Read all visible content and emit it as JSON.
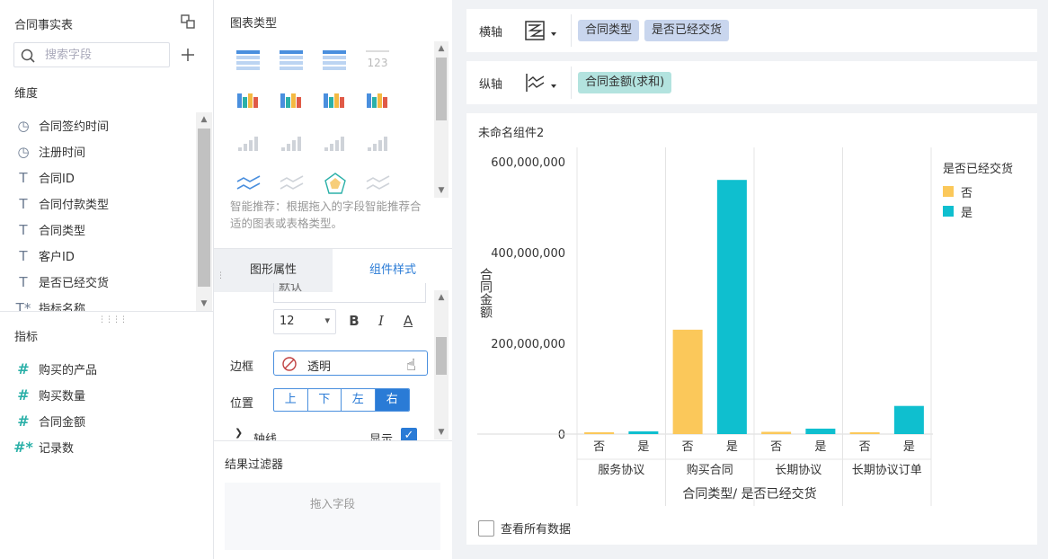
{
  "left_panel": {
    "title": "合同事实表",
    "search_placeholder": "搜索字段",
    "dimension_label": "维度",
    "dimensions": [
      {
        "icon": "clock-icon",
        "label": "合同签约时间"
      },
      {
        "icon": "clock-icon",
        "label": "注册时间"
      },
      {
        "icon": "text-icon",
        "label": "合同ID"
      },
      {
        "icon": "text-icon",
        "label": "合同付款类型"
      },
      {
        "icon": "text-icon",
        "label": "合同类型"
      },
      {
        "icon": "text-icon",
        "label": "客户ID"
      },
      {
        "icon": "text-icon",
        "label": "是否已经交货"
      },
      {
        "icon": "calculated-text-icon",
        "label": "指标名称"
      }
    ],
    "measure_label": "指标",
    "measures": [
      {
        "icon": "number-icon",
        "label": "购买的产品"
      },
      {
        "icon": "number-icon",
        "label": "购买数量"
      },
      {
        "icon": "number-icon",
        "label": "合同金额"
      },
      {
        "icon": "calculated-number-icon",
        "label": "记录数"
      }
    ]
  },
  "middle_panel": {
    "chart_type_title": "图表类型",
    "chart_type_icons": [
      "grouped-table-icon",
      "detail-table-icon",
      "cross-table-icon",
      "kpi-number-icon",
      "text-table-icon",
      "kpi-card-icon",
      "heatmap-icon",
      "multi-series-bar-icon",
      "grouped-bar-icon",
      "bar-chart-icon",
      "range-bar-icon",
      "waterfall-icon",
      "line-chart-icon",
      "polyline-icon",
      "radar-icon",
      "area-chart-icon"
    ],
    "smart_hint": "智能推荐：根据拖入的字段智能推荐合适的图表或表格类型。",
    "tabs": {
      "graph": "图形属性",
      "component": "组件样式"
    },
    "font_family_value": "默认",
    "font_size_value": "12",
    "bold_label": "B",
    "italic_label": "I",
    "underline_label": "A",
    "border_label": "边框",
    "border_value": "透明",
    "position_label": "位置",
    "position_options": [
      "上",
      "下",
      "左",
      "右"
    ],
    "position_selected": "右",
    "axis_label": "轴线",
    "axis_show_label": "显示",
    "axis_show_checked": true,
    "filter_title": "结果过滤器",
    "filter_placeholder": "拖入字段"
  },
  "right_panel": {
    "x_axis_label": "横轴",
    "x_axis_fields": [
      "合同类型",
      "是否已经交货"
    ],
    "y_axis_label": "纵轴",
    "y_axis_fields": [
      "合同金额(求和)"
    ],
    "component_title": "未命名组件2",
    "view_all_label": "查看所有数据",
    "view_all_checked": false
  },
  "chart_data": {
    "type": "bar",
    "categories": [
      "服务协议",
      "购买合同",
      "长期协议",
      "长期协议订单"
    ],
    "subcategories": [
      "否",
      "是"
    ],
    "series": [
      {
        "name": "否",
        "color": "#fbc85a",
        "values": [
          1000000,
          230000000,
          5000000,
          1500000
        ]
      },
      {
        "name": "是",
        "color": "#0fbfcf",
        "values": [
          6000000,
          560000000,
          12000000,
          62000000
        ]
      }
    ],
    "legend_title": "是否已经交货",
    "legend_position": "right",
    "ylabel": "合同金额",
    "xlabel": "合同类型/ 是否已经交货",
    "yticks": [
      "600,000,000",
      "400,000,000",
      "200,000,000",
      "0"
    ],
    "ytick_values": [
      600000000,
      400000000,
      200000000,
      0
    ],
    "ylim": [
      0,
      600000000
    ]
  }
}
